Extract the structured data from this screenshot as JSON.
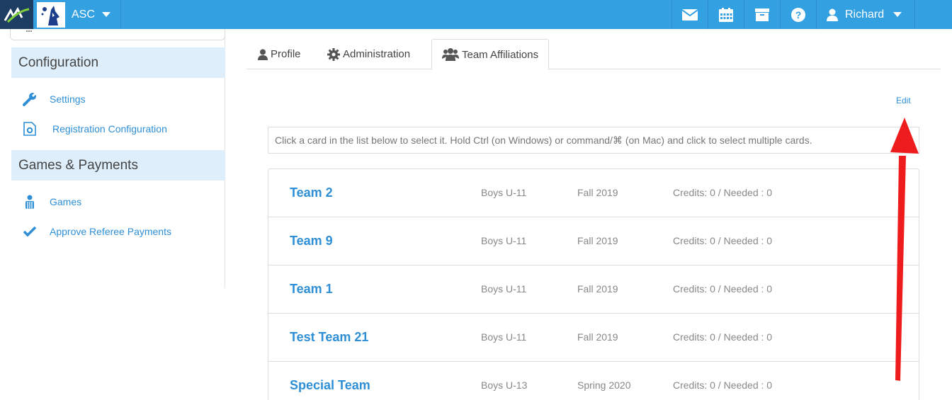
{
  "topbar": {
    "org_name": "ASC",
    "user_name": "Richard",
    "icons": [
      "envelope-icon",
      "calendar-icon",
      "archive-icon",
      "help-icon",
      "user-icon"
    ],
    "brand_color": "#33a0e2"
  },
  "sidebar": {
    "sections": [
      {
        "title": "Configuration",
        "items": [
          {
            "label": "Settings",
            "icon": "wrench-icon"
          },
          {
            "label": "Registration Configuration",
            "icon": "file-gear-icon"
          }
        ]
      },
      {
        "title": "Games & Payments",
        "items": [
          {
            "label": "Games",
            "icon": "referee-icon"
          },
          {
            "label": "Approve Referee Payments",
            "icon": "check-icon"
          }
        ]
      }
    ]
  },
  "tabs": [
    {
      "label": "Profile",
      "icon": "user-icon",
      "active": false
    },
    {
      "label": "Administration",
      "icon": "gear-icon",
      "active": false
    },
    {
      "label": "Team Affiliations",
      "icon": "users-icon",
      "active": true
    }
  ],
  "edit_label": "Edit",
  "hint": "Click a card in the list below to select it. Hold Ctrl (on Windows) or command/⌘ (on Mac) and click to select multiple cards.",
  "teams": [
    {
      "name": "Team 2",
      "division": "Boys U-11",
      "season": "Fall 2019",
      "credits": "Credits: 0 / Needed : 0"
    },
    {
      "name": "Team 9",
      "division": "Boys U-11",
      "season": "Fall 2019",
      "credits": "Credits: 0 / Needed : 0"
    },
    {
      "name": "Team 1",
      "division": "Boys U-11",
      "season": "Fall 2019",
      "credits": "Credits: 0 / Needed : 0"
    },
    {
      "name": "Test Team 21",
      "division": "Boys U-11",
      "season": "Fall 2019",
      "credits": "Credits: 0 / Needed : 0"
    },
    {
      "name": "Special Team",
      "division": "Boys U-13",
      "season": "Spring 2020",
      "credits": "Credits: 0 / Needed : 0"
    }
  ],
  "annotation_color": "#ee1c1c"
}
